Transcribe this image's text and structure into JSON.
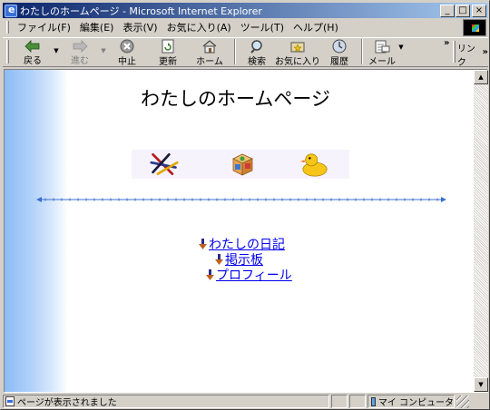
{
  "window": {
    "title": "わたしのホームページ - Microsoft Internet Explorer",
    "controls": [
      "_",
      "□",
      "×"
    ]
  },
  "menubar": {
    "items": [
      "ファイル(F)",
      "編集(E)",
      "表示(V)",
      "お気に入り(A)",
      "ツール(T)",
      "ヘルプ(H)"
    ]
  },
  "toolbar": {
    "back": "戻る",
    "forward": "進む",
    "stop": "中止",
    "refresh": "更新",
    "home": "ホーム",
    "search": "検索",
    "favorites": "お気に入り",
    "history": "履歴",
    "mail": "メール",
    "chevron": "»",
    "links_label": "リンク",
    "links_chevron": "»"
  },
  "page": {
    "title": "わたしのホームページ",
    "links": [
      "わたしの日記",
      "掲示板",
      "プロフィール"
    ]
  },
  "status": {
    "text": "ページが表示されました",
    "zone": "マイ コンピュータ"
  },
  "colors": {
    "titlebar_start": "#0a246a",
    "titlebar_end": "#a6caf0",
    "link": "#0000ee",
    "band": "#8ebcf6",
    "divider": "#3b6fd0"
  },
  "icons": {
    "strip": [
      "chopsticks-icon",
      "toy-block-icon",
      "rubber-duck-icon"
    ],
    "link_bullet": "arrow-down-icon"
  }
}
